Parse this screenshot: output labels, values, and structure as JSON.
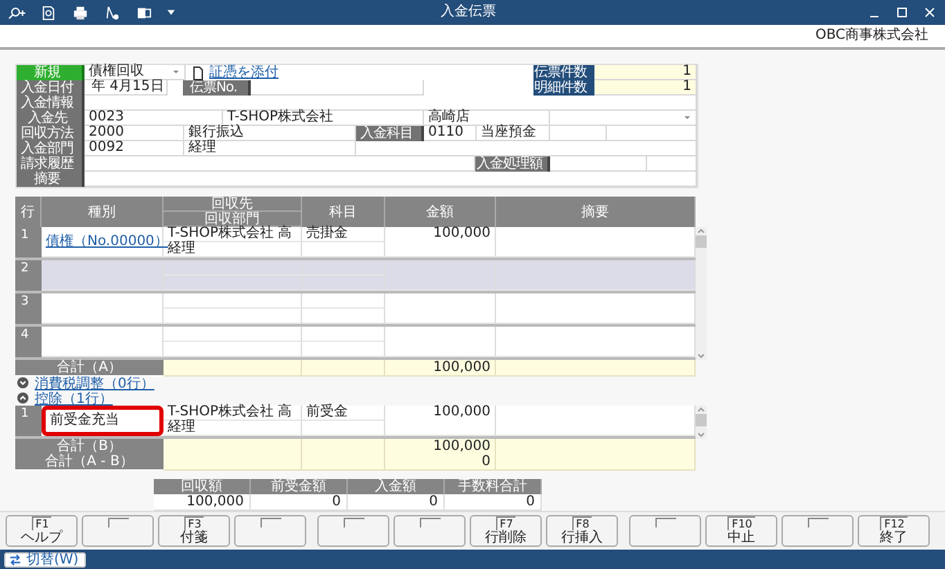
{
  "window": {
    "title": "入金伝票",
    "company": "OBC商事株式会社"
  },
  "header": {
    "mode": "新規",
    "type": "債権回収",
    "attach_link": "証憑を添付",
    "date_label": "入金日付",
    "date": "年 4月15日",
    "slip_no_label": "伝票No.",
    "slip_count_label": "伝票件数",
    "slip_count": "1",
    "detail_count_label": "明細件数",
    "detail_count": "1",
    "info_label": "入金情報",
    "payer_label": "入金先",
    "payer_code": "0023",
    "payer_name": "T-SHOP株式会社",
    "payer_branch": "高崎店",
    "method_label": "回収方法",
    "method_code": "2000",
    "method_name": "銀行振込",
    "account_label": "入金科目",
    "account_code": "0110",
    "account_name": "当座預金",
    "dept_label": "入金部門",
    "dept_code": "0092",
    "dept_name": "経理",
    "history_label": "請求履歴",
    "processed_label": "入金処理額",
    "memo_label": "摘要"
  },
  "grid": {
    "columns": [
      "行",
      "種別",
      "回収先",
      "回収部門",
      "科目",
      "金額",
      "摘要"
    ],
    "rows": [
      {
        "no": "1",
        "selected": false,
        "kind": "債権（No.00000）",
        "payee": "T-SHOP株式会社 高",
        "dept": "経理",
        "account": "売掛金",
        "amount": "100,000"
      },
      {
        "no": "2",
        "selected": true
      },
      {
        "no": "3",
        "selected": false
      },
      {
        "no": "4",
        "selected": false
      }
    ],
    "total_label": "合計（A）",
    "total": "100,000"
  },
  "sections": [
    {
      "label": "消費税調整（0行）",
      "expanded": false
    },
    {
      "label": "控除（1行）",
      "expanded": true
    }
  ],
  "deductions": {
    "rows": [
      {
        "no": "1",
        "kind": "前受金充当",
        "highlighted": true,
        "payee": "T-SHOP株式会社 高",
        "dept": "経理",
        "account": "前受金",
        "amount": "100,000"
      }
    ],
    "total_b_label": "合計（B）",
    "total_b": "100,000",
    "total_ab_label": "合計（A - B）",
    "total_ab": "0"
  },
  "summary": [
    {
      "label": "回収額",
      "value": "100,000"
    },
    {
      "label": "前受金額",
      "value": "0"
    },
    {
      "label": "入金額",
      "value": "0"
    },
    {
      "label": "手数料合計",
      "value": "0"
    }
  ],
  "fkeys": [
    {
      "assigned": true,
      "key": "F1",
      "label": "ヘルプ"
    },
    {
      "assigned": false
    },
    {
      "assigned": true,
      "key": "F3",
      "label": "付箋"
    },
    {
      "assigned": false
    },
    {
      "assigned": false
    },
    {
      "assigned": false
    },
    {
      "assigned": true,
      "key": "F7",
      "label": "行削除"
    },
    {
      "assigned": true,
      "key": "F8",
      "label": "行挿入"
    },
    {
      "assigned": false
    },
    {
      "assigned": true,
      "key": "F10",
      "label": "中止"
    },
    {
      "assigned": false
    },
    {
      "assigned": true,
      "key": "F12",
      "label": "終了"
    }
  ],
  "status_bar": {
    "switch_button": "切替(W)"
  }
}
